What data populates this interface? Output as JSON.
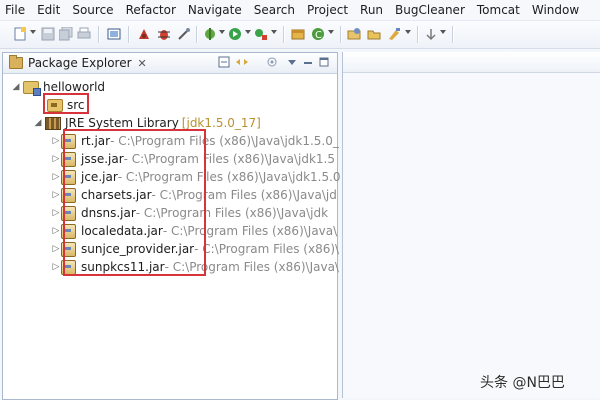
{
  "menu": [
    "File",
    "Edit",
    "Source",
    "Refactor",
    "Navigate",
    "Search",
    "Project",
    "Run",
    "BugCleaner",
    "Tomcat",
    "Window"
  ],
  "panel": {
    "title": "Package Explorer",
    "close_glyph": "✕"
  },
  "tree": {
    "project": "helloworld",
    "src": "src",
    "library": {
      "name": "JRE System Library",
      "version": "[jdk1.5.0_17]"
    },
    "jars": [
      {
        "name": "rt.jar",
        "path": " - C:\\Program Files (x86)\\Java\\jdk1.5.0_"
      },
      {
        "name": "jsse.jar",
        "path": " - C:\\Program Files (x86)\\Java\\jdk1.5"
      },
      {
        "name": "jce.jar",
        "path": " - C:\\Program Files (x86)\\Java\\jdk1.5.0"
      },
      {
        "name": "charsets.jar",
        "path": " - C:\\Program Files (x86)\\Java\\jd"
      },
      {
        "name": "dnsns.jar",
        "path": " - C:\\Program Files (x86)\\Java\\jdk"
      },
      {
        "name": "localedata.jar",
        "path": " - C:\\Program Files (x86)\\Java\\"
      },
      {
        "name": "sunjce_provider.jar",
        "path": " - C:\\Program Files (x86)\\"
      },
      {
        "name": "sunpkcs11.jar",
        "path": " - C:\\Program Files (x86)\\Java\\"
      }
    ]
  },
  "watermark": "头条 @N巴巴",
  "colors": {
    "highlight": "#d6333a",
    "path_gray": "#8a8a8a",
    "version_gold": "#b8922f"
  }
}
